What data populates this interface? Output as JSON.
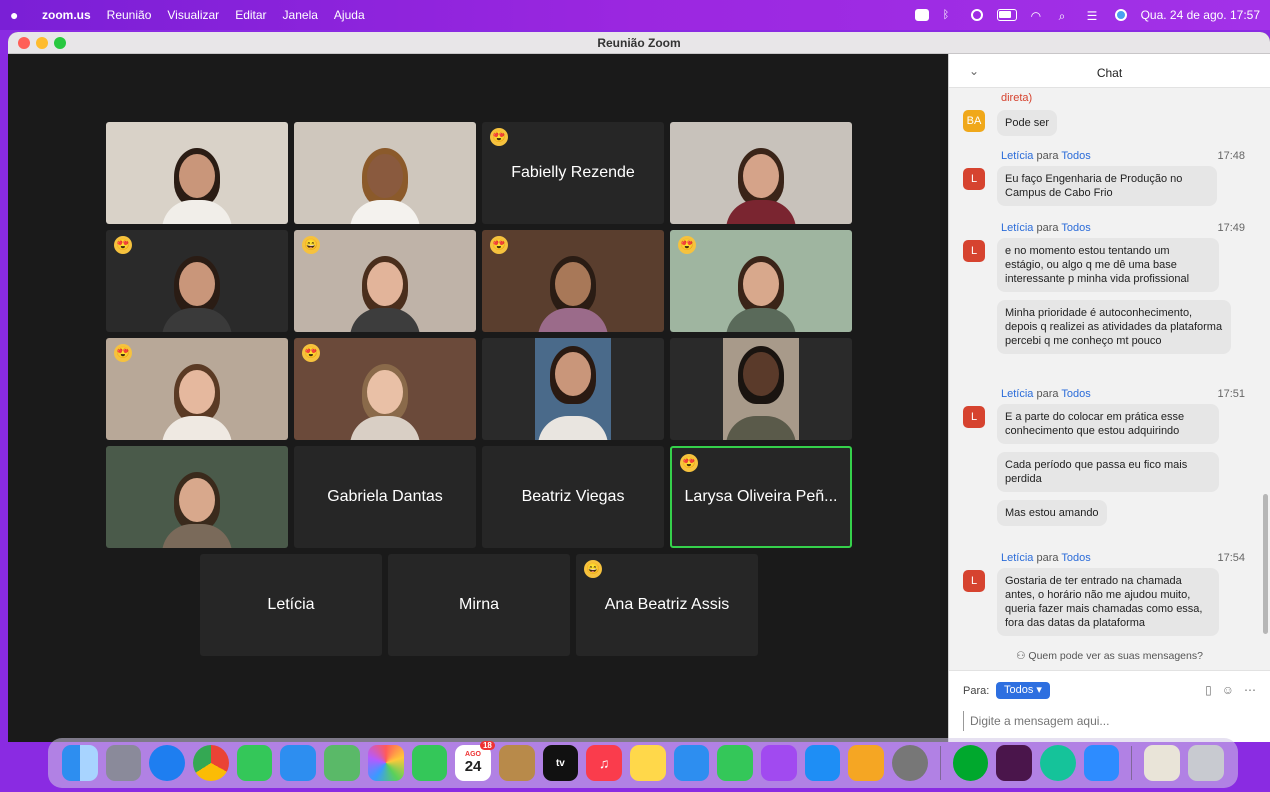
{
  "menubar": {
    "app": "zoom.us",
    "items": [
      "Reunião",
      "Visualizar",
      "Editar",
      "Janela",
      "Ajuda"
    ],
    "clock": "Qua. 24 de ago.  17:57"
  },
  "window": {
    "title": "Reunião Zoom"
  },
  "gallery": {
    "tiles": [
      {
        "name": "",
        "emoji": ""
      },
      {
        "name": "",
        "emoji": ""
      },
      {
        "name": "Fabielly Rezende",
        "emoji": "😍"
      },
      {
        "name": "",
        "emoji": ""
      },
      {
        "name": "",
        "emoji": "😍"
      },
      {
        "name": "",
        "emoji": "😄"
      },
      {
        "name": "",
        "emoji": "😍"
      },
      {
        "name": "",
        "emoji": "😍"
      },
      {
        "name": "",
        "emoji": "😍"
      },
      {
        "name": "",
        "emoji": "😍"
      },
      {
        "name": "",
        "emoji": ""
      },
      {
        "name": "",
        "emoji": ""
      },
      {
        "name": "",
        "emoji": ""
      },
      {
        "name": "Gabriela Dantas",
        "emoji": ""
      },
      {
        "name": "Beatriz Viegas",
        "emoji": ""
      },
      {
        "name": "Larysa Oliveira Peñ...",
        "emoji": "😍"
      },
      {
        "name": "Letícia",
        "emoji": ""
      },
      {
        "name": "Mirna",
        "emoji": ""
      },
      {
        "name": "Ana Beatriz Assis",
        "emoji": "😄"
      }
    ]
  },
  "chat": {
    "title": "Chat",
    "collapse_icon": "⌄",
    "messages": {
      "m0_text": "direta)",
      "m1_avatar": "BA",
      "m1_text": "Pode ser",
      "m2_from": "Letícia",
      "m2_mid": " para ",
      "m2_to": "Todos",
      "m2_time": "17:48",
      "m2_avatar": "L",
      "m2_text": "Eu faço Engenharia de Produção no Campus de Cabo Frio",
      "m3_from": "Letícia",
      "m3_mid": " para ",
      "m3_to": "Todos",
      "m3_time": "17:49",
      "m3_avatar": "L",
      "m3_text": "e no momento estou tentando um estágio, ou algo q me dê uma base interessante p minha vida profissional",
      "m3b_text": "Minha prioridade é autoconhecimento, depois q realizei as atividades da plataforma percebi q me conheço mt pouco",
      "m4_from": "Letícia",
      "m4_mid": " para ",
      "m4_to": "Todos",
      "m4_time": "17:51",
      "m4_avatar": "L",
      "m4_text": "E a parte do colocar em prática esse conhecimento que estou adquirindo",
      "m4b_text": "Cada período que passa eu fico mais perdida",
      "m4c_text": "Mas estou amando",
      "m5_from": "Letícia",
      "m5_mid": " para ",
      "m5_to": "Todos",
      "m5_time": "17:54",
      "m5_avatar": "L",
      "m5_text": "Gostaria de ter entrado na chamada antes, o horário não me ajudou muito, queria fazer mais chamadas como essa, fora das datas da plataforma"
    },
    "who_sees": "Quem pode ver as suas mensagens?",
    "para_label": "Para:",
    "recipient": "Todos ▾",
    "placeholder": "Digite a mensagem aqui..."
  },
  "dock": {
    "calendar_month": "AGO",
    "calendar_day": "24",
    "calendar_badge": "18",
    "tv_label": "tv"
  }
}
